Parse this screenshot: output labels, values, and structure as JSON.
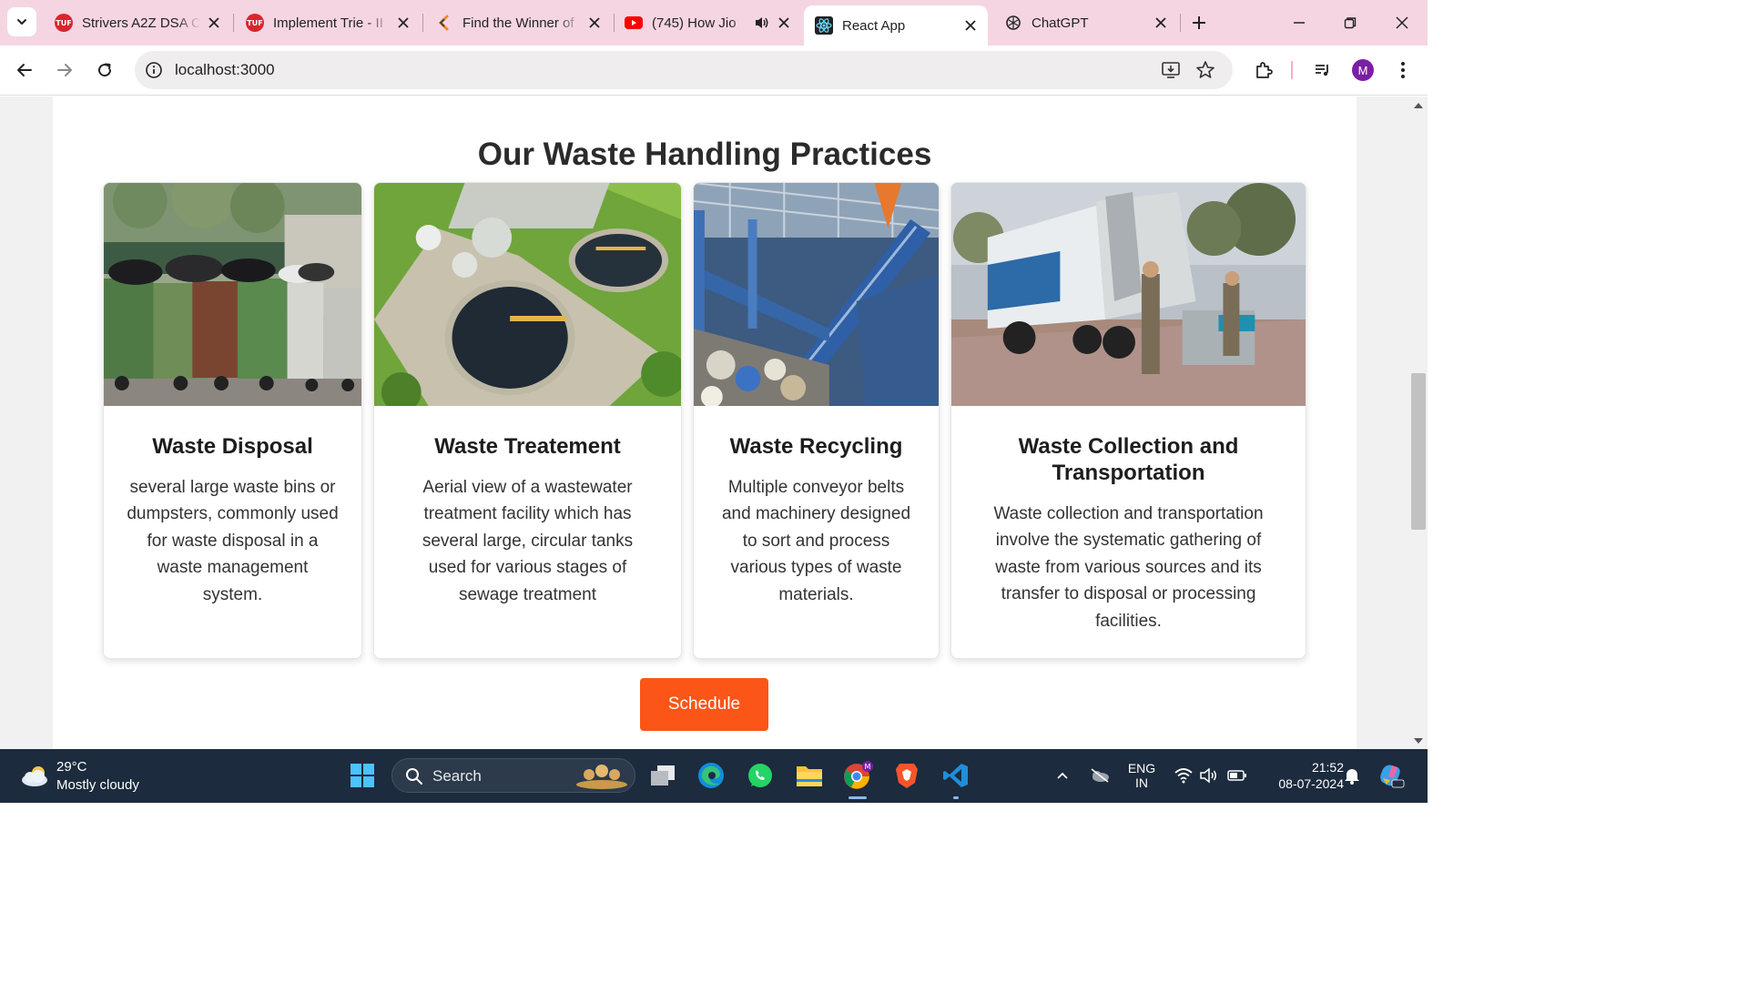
{
  "browser": {
    "tabs": [
      {
        "title": "Strivers A2Z DSA C",
        "favicon": "tuf-logo-icon",
        "active": false
      },
      {
        "title": "Implement Trie - II",
        "favicon": "tuf-logo-icon",
        "active": false
      },
      {
        "title": "Find the Winner of",
        "favicon": "codestudio-logo-icon",
        "active": false
      },
      {
        "title": "(745) How Jio",
        "favicon": "youtube-icon",
        "active": false,
        "audio": true
      },
      {
        "title": "React App",
        "favicon": "react-logo-icon",
        "active": true
      },
      {
        "title": "ChatGPT",
        "favicon": "chatgpt-logo-icon",
        "active": false
      }
    ],
    "favicon_text": "TUF",
    "address_bar": {
      "url": "localhost:3000"
    },
    "profile_initial": "M",
    "colors": {
      "tabstrip": "#f6d5e3",
      "active_tab": "#ffffff",
      "omnibox": "#efeded",
      "avatar": "#7b1fa2"
    }
  },
  "page": {
    "section_title": "Our Waste Handling Practices",
    "cards": [
      {
        "title": "Waste Disposal",
        "description": "several large waste bins or dumpsters, commonly used for waste disposal in a waste management system.",
        "image": "dumpsters-photo"
      },
      {
        "title": "Waste Treatement",
        "description": "Aerial view of a wastewater treatment facility which has several large, circular tanks used for various stages of sewage treatment",
        "image": "treatment-plant-photo"
      },
      {
        "title": "Waste Recycling",
        "description": "Multiple conveyor belts and machinery designed to sort and process various types of waste materials.",
        "image": "recycling-conveyor-photo"
      },
      {
        "title": "Waste Collection and Transportation",
        "description": "Waste collection and transportation involve the systematic gathering of waste from various sources and its transfer to disposal or processing facilities.",
        "image": "garbage-truck-photo"
      }
    ],
    "schedule_button": "Schedule",
    "colors": {
      "button": "#fb5518"
    }
  },
  "taskbar": {
    "weather": {
      "temp": "29°C",
      "desc": "Mostly cloudy"
    },
    "search_label": "Search",
    "language": {
      "line1": "ENG",
      "line2": "IN"
    },
    "clock": {
      "time": "21:52",
      "date": "08-07-2024"
    },
    "apps": [
      "windows-start-icon",
      "search-icon",
      "task-view-icon",
      "edge-icon",
      "whatsapp-icon",
      "file-explorer-icon",
      "chrome-icon",
      "brave-icon",
      "vscode-icon"
    ]
  }
}
